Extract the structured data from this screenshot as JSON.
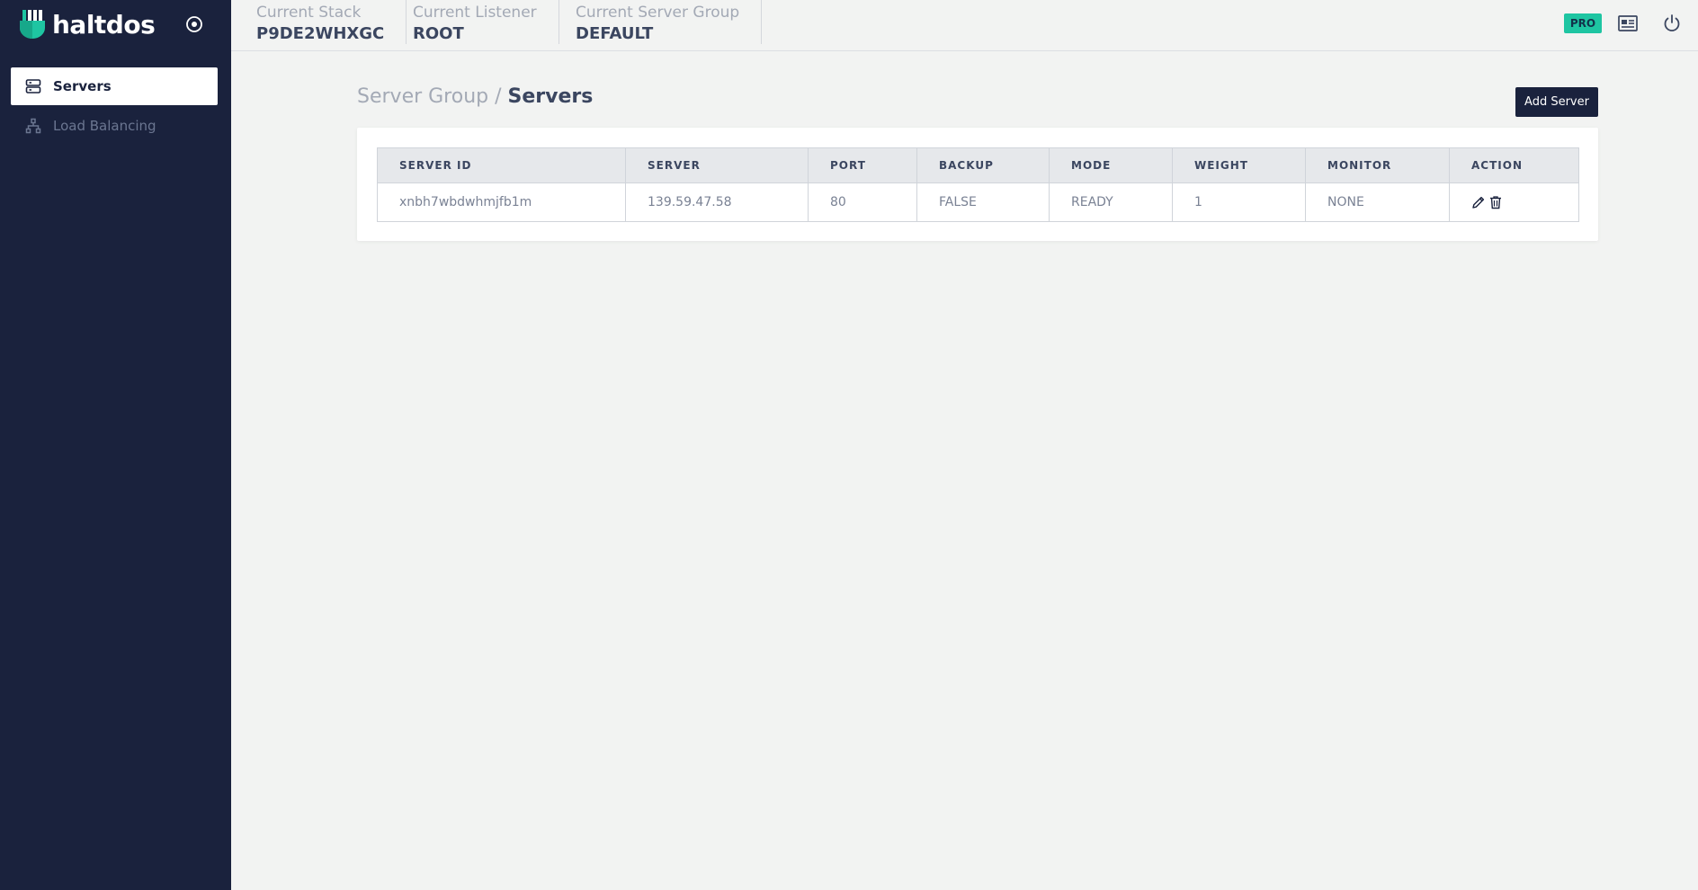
{
  "brand": {
    "name": "haltdos"
  },
  "sidebar": {
    "items": [
      {
        "label": "Servers",
        "icon": "server-icon",
        "active": true
      },
      {
        "label": "Load Balancing",
        "icon": "sitemap-icon",
        "active": false
      }
    ]
  },
  "header": {
    "context": [
      {
        "label": "Current Stack",
        "value": "P9DE2WHXGC"
      },
      {
        "label": "Current Listener",
        "value": "ROOT"
      },
      {
        "label": "Current Server Group",
        "value": "DEFAULT"
      }
    ],
    "badge": "PRO",
    "icons": [
      "news-icon",
      "power-icon"
    ]
  },
  "breadcrumb": {
    "parent": "Server Group",
    "separator": " / ",
    "current": "Servers"
  },
  "toolbar": {
    "add_label": "Add Server"
  },
  "table": {
    "columns": [
      "SERVER ID",
      "SERVER",
      "PORT",
      "BACKUP",
      "MODE",
      "WEIGHT",
      "MONITOR",
      "ACTION"
    ],
    "rows": [
      {
        "server_id": "xnbh7wbdwhmjfb1m",
        "server": "139.59.47.58",
        "port": "80",
        "backup": "FALSE",
        "mode": "READY",
        "weight": "1",
        "monitor": "NONE"
      }
    ]
  },
  "colors": {
    "sidebar_bg": "#1a223d",
    "accent": "#1ec5a2",
    "page_bg": "#f2f3f2"
  }
}
